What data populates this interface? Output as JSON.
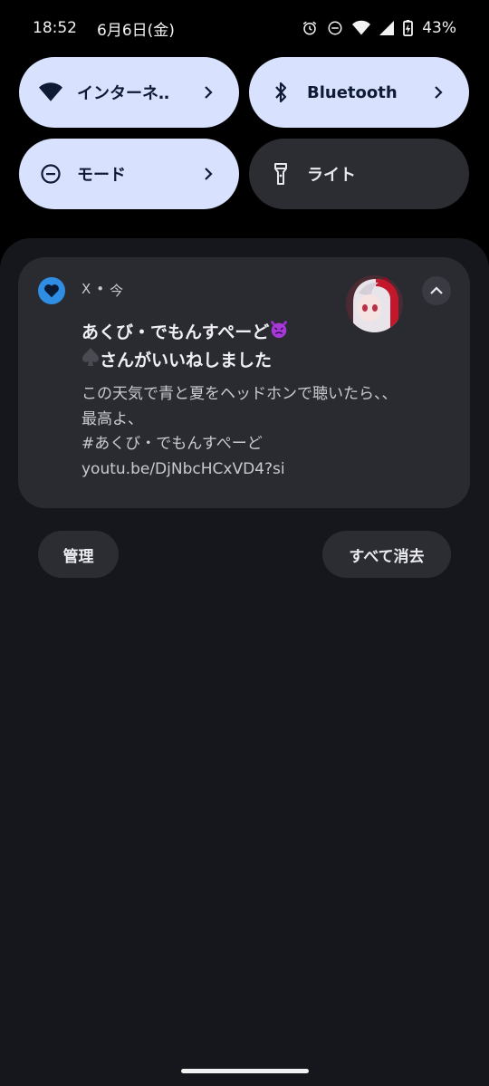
{
  "status_bar": {
    "time": "18:52",
    "date": "6月6日(金)",
    "battery": "43%",
    "icons": [
      "alarm-icon",
      "do-not-disturb-icon",
      "wifi-icon",
      "signal-icon",
      "battery-icon"
    ]
  },
  "quick_settings": {
    "tiles": [
      {
        "label": "インターネ‥",
        "icon": "wifi-icon",
        "state": "on",
        "chevron": true
      },
      {
        "label": "Bluetooth",
        "icon": "bluetooth-icon",
        "state": "on",
        "chevron": true
      },
      {
        "label": "モード",
        "icon": "do-not-disturb-icon",
        "state": "on",
        "chevron": true
      },
      {
        "label": "ライト",
        "icon": "flashlight-icon",
        "state": "off",
        "chevron": false
      }
    ]
  },
  "notification": {
    "app_name": "X",
    "separator": "•",
    "time": "今",
    "app_icon": "heart-icon",
    "title_line1": "あくび・でもんすぺーど",
    "title_line2": "さんがいいねしました",
    "emoji_devil": "devil-emoji",
    "emoji_spade": "spade-icon",
    "body_lines": [
      "この天気で青と夏をヘッドホンで聴いたら、、",
      "最高よ、",
      "#あくび・でもんすぺーど",
      "youtu.be/DjNbcHCxVD4?si"
    ]
  },
  "actions": {
    "manage_label": "管理",
    "clear_all_label": "すべて消去"
  },
  "colors": {
    "tile_on": "#d8e2ff",
    "tile_off": "#2b2d33",
    "app_icon": "#2f8de4",
    "shade": "#16171c",
    "card": "#2a2b31"
  }
}
